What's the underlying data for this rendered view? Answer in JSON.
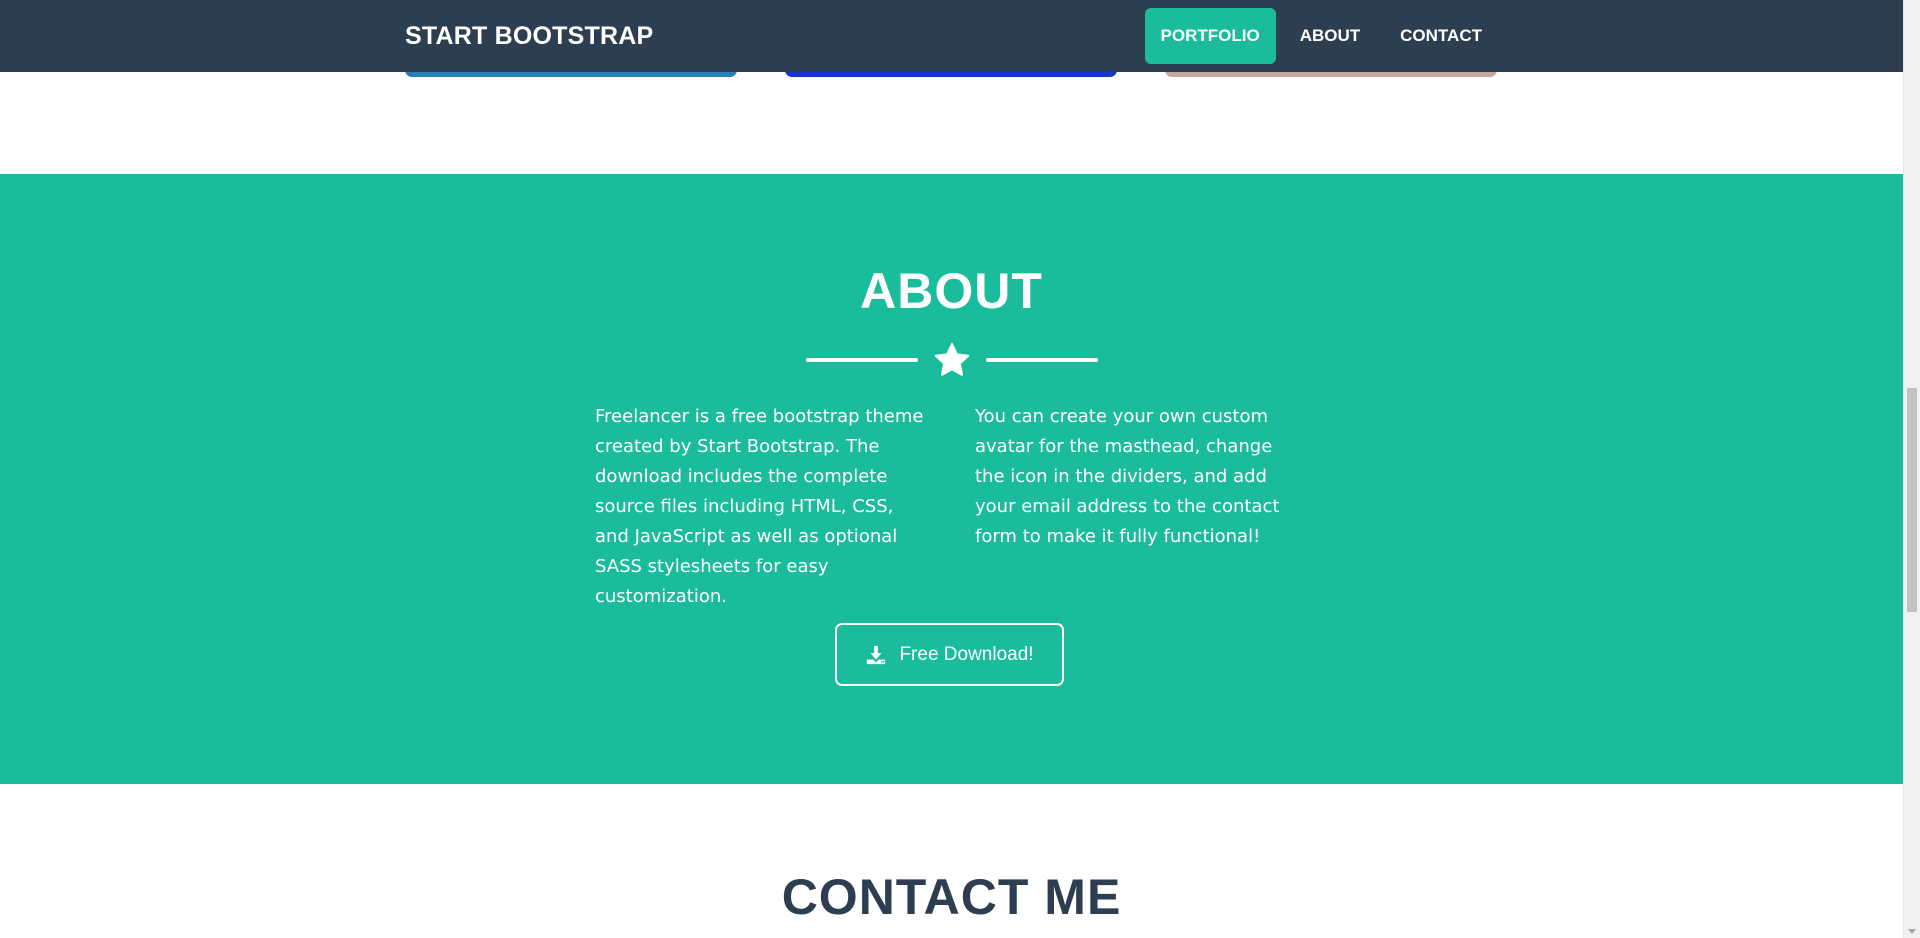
{
  "colors": {
    "navbar_bg": "#2c3e50",
    "accent": "#1abc9c",
    "about_bg": "#1abc9c",
    "contact_title": "#2c3e50",
    "card_1": "#2980b9",
    "card_2": "#1a35c9",
    "card_3": "#c9a59f"
  },
  "navbar": {
    "brand": "START BOOTSTRAP",
    "items": [
      {
        "label": "PORTFOLIO",
        "active": true
      },
      {
        "label": "ABOUT",
        "active": false
      },
      {
        "label": "CONTACT",
        "active": false
      }
    ]
  },
  "about": {
    "title": "ABOUT",
    "divider_icon": "star-icon",
    "paragraph_left": "Freelancer is a free bootstrap theme created by Start Bootstrap. The download includes the complete source files including HTML, CSS, and JavaScript as well as optional SASS stylesheets for easy customization.",
    "paragraph_right": "You can create your own custom avatar for the masthead, change the icon in the dividers, and add your email address to the contact form to make it fully functional!",
    "download_label": "Free Download!",
    "download_icon": "download-icon"
  },
  "contact": {
    "title": "CONTACT ME"
  },
  "scrollbar": {
    "position_fraction": 0.5
  }
}
